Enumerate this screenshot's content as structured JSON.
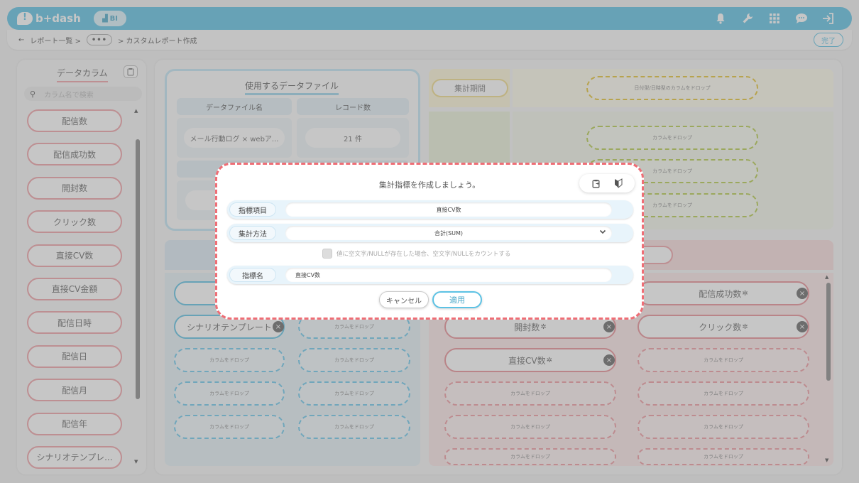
{
  "header": {
    "logo_text": "b+dash",
    "badge_label": "BI",
    "icons": [
      "bell-icon",
      "wrench-icon",
      "grid-icon",
      "chat-icon",
      "logout-icon"
    ]
  },
  "breadcrumb": {
    "back_symbol": "←",
    "items": [
      "レポート一覧 >",
      "•••",
      "> カスタムレポート作成"
    ],
    "done_label": "完了"
  },
  "left_panel": {
    "title": "データカラム",
    "search_placeholder": "カラム名で検索",
    "columns": [
      "配信数",
      "配信成功数",
      "開封数",
      "クリック数",
      "直接CV数",
      "直接CV金額",
      "配信日時",
      "配信日",
      "配信月",
      "配信年",
      "シナリオテンプレ..."
    ]
  },
  "data_file": {
    "title": "使用するデータファイル",
    "col_headers": [
      "データファイル名",
      "レコード数"
    ],
    "rows": [
      {
        "name": "メール行動ログ × webア...",
        "records": "21 件"
      }
    ]
  },
  "period": {
    "label": "集計期間",
    "drop_hint": "日付型/日時型のカラムをドロップ"
  },
  "drop_hint": "カラムをドロップ",
  "blue_area": {
    "items": [
      "シナリオテンプレート"
    ]
  },
  "red_area": {
    "items": [
      "配信成功数",
      "開封数",
      "クリック数",
      "直接CV数"
    ]
  },
  "modal": {
    "title": "集計指標を作成しましょう。",
    "metric_label": "指標項目",
    "metric_value": "直接CV数",
    "agg_label": "集計方法",
    "agg_value": "合計(SUM)",
    "null_check_label": "値に空文字/NULLが存在した場合、空文字/NULLをカウントする",
    "name_label": "指標名",
    "name_value": "直接CV数",
    "cancel_label": "キャンセル",
    "apply_label": "適用"
  },
  "colors": {
    "accent_blue": "#5cc2e4",
    "accent_red": "#ee6e76"
  }
}
